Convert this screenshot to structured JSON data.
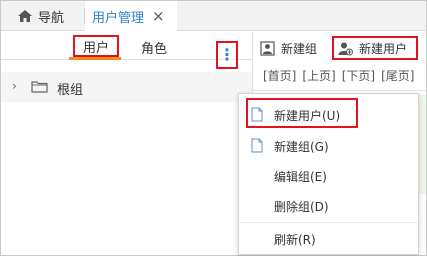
{
  "tabs": {
    "nav_label": "导航",
    "active_label": "用户管理",
    "close_glyph": "×"
  },
  "left": {
    "subtabs": {
      "user": "用户",
      "role": "角色"
    },
    "tree": {
      "expand_glyph": "›",
      "root_label": "根组",
      "more_glyph": "⋮"
    }
  },
  "right": {
    "toolbar": {
      "new_group": "新建组",
      "new_user": "新建用户"
    },
    "pager": [
      "[首页]",
      "[上页]",
      "[下页]",
      "[尾页]"
    ]
  },
  "context_menu": {
    "items": [
      {
        "label": "新建用户(U)",
        "icon": "document-icon"
      },
      {
        "label": "新建组(G)",
        "icon": "document-icon"
      },
      {
        "label": "编辑组(E)",
        "icon": ""
      },
      {
        "label": "删除组(D)",
        "icon": ""
      },
      {
        "label": "刷新(R)",
        "icon": ""
      }
    ]
  },
  "colors": {
    "accent_blue": "#2f7fd0",
    "highlight_red": "#e0141a",
    "active_underline": "#f08a24"
  },
  "icons": [
    "home-icon",
    "close-icon",
    "chevron-right-icon",
    "folder-icon",
    "more-vertical-icon",
    "user-group-icon",
    "add-user-icon",
    "document-icon"
  ]
}
